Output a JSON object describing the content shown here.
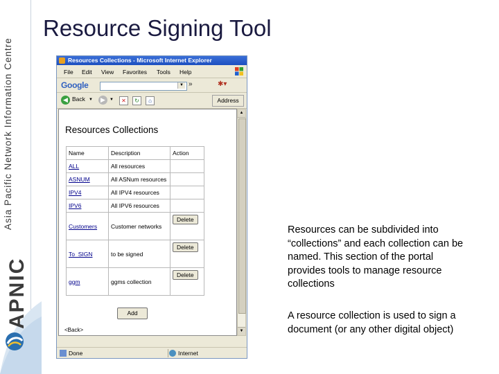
{
  "brand": {
    "vertical_text": "Asia Pacific Network Information Centre",
    "name": "APNIC"
  },
  "slide": {
    "title": "Resource Signing Tool"
  },
  "browser": {
    "window_title": "Resources Collections - Microsoft Internet Explorer",
    "menu": [
      "File",
      "Edit",
      "View",
      "Favorites",
      "Tools",
      "Help"
    ],
    "google_label": "Google",
    "more_glyph": "»",
    "back_label": "Back",
    "address_label": "Address",
    "status_left": "Done",
    "status_right": "Internet"
  },
  "page": {
    "heading": "Resources Collections",
    "columns": [
      "Name",
      "Description",
      "Action"
    ],
    "rows": [
      {
        "name": "ALL",
        "description": "All resources",
        "action": ""
      },
      {
        "name": "ASNUM",
        "description": "All ASNum resources",
        "action": ""
      },
      {
        "name": "IPV4",
        "description": "All IPV4 resources",
        "action": ""
      },
      {
        "name": "IPV6",
        "description": "All IPV6 resources",
        "action": ""
      },
      {
        "name": "Customers",
        "description": "Customer networks",
        "action": "Delete"
      },
      {
        "name": "To_SIGN",
        "description": "to be signed",
        "action": "Delete"
      },
      {
        "name": "ggm",
        "description": "ggms collection",
        "action": "Delete"
      }
    ],
    "add_label": "Add",
    "back_link": "<Back>"
  },
  "description": {
    "p1": "Resources can be subdivided into “collections” and each collection can be named. This section of the portal provides tools to manage resource collections",
    "p2": "A resource collection is used to sign a document (or any other digital object)"
  },
  "colors": {
    "title_text": "#1a1a40",
    "titlebar": "#1d4fbf",
    "link": "#00008b"
  }
}
